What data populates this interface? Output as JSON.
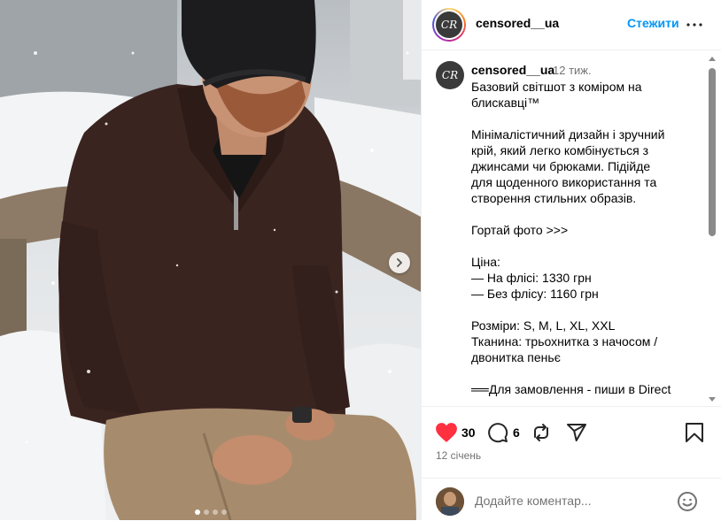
{
  "post": {
    "username": "censored__ua",
    "follow_label": "Стежити",
    "avatar_mark": "CR",
    "carousel_pages": 4,
    "carousel_active": 1
  },
  "caption": {
    "username": "censored__ua",
    "time_ago": "12 тиж.",
    "text": "Базовий світшот з коміром на блискавці™\n\nМінімалістичний дизайн і зручний крій, який легко комбінується з джинсами чи брюками. Підійде для щоденного використання та створення стильних образів.\n\nГортай фото >>>\n\nЦіна:\n— На флісі: 1330 грн\n— Без флісу: 1160 грн\n\nРозміри: S, M, L, XL, XXL\nТканина: трьохнитка з начосом / двонитка пеньє\n\n══Для замовлення - пиши в Direct"
  },
  "actions": {
    "likes": "30",
    "comments": "6",
    "date": "12 січень"
  },
  "comment_box": {
    "placeholder": "Додайте коментар..."
  },
  "icons": {
    "like": "heart-filled-icon",
    "comment": "comment-bubble-icon",
    "repost": "repost-icon",
    "share": "send-icon",
    "save": "bookmark-icon",
    "more": "more-dots-icon",
    "emoji": "emoji-smile-icon",
    "next": "chevron-right-icon"
  },
  "colors": {
    "accent": "#0095f6",
    "like": "#ff3040",
    "muted": "#737373"
  }
}
